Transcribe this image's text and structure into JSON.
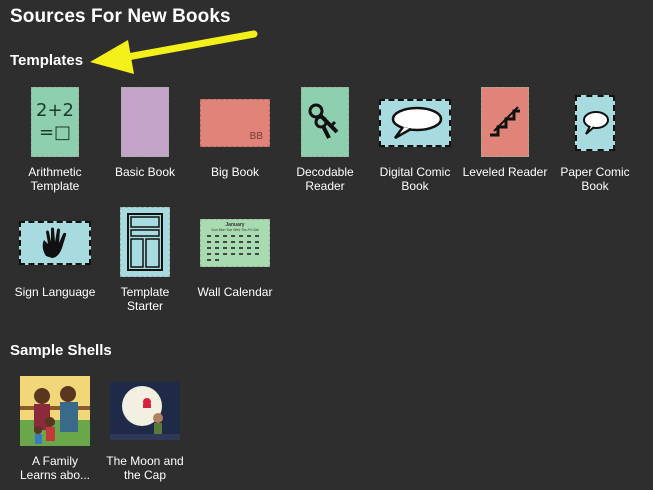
{
  "page_title": "Sources For New Books",
  "sections": {
    "templates": {
      "title": "Templates"
    },
    "sample_shells": {
      "title": "Sample Shells"
    }
  },
  "templates": [
    {
      "label": "Arithmetic Template",
      "thumb_text": "2+2\n=□",
      "color": "#8ecfb0"
    },
    {
      "label": "Basic Book",
      "color": "#c4a4c8"
    },
    {
      "label": "Big Book",
      "thumb_text": "BB",
      "color": "#e0847a"
    },
    {
      "label": "Decodable Reader",
      "color": "#8ecfb0",
      "icon": "keys-icon"
    },
    {
      "label": "Digital Comic Book",
      "color": "#a8dbe0",
      "icon": "speech-bubble-icon"
    },
    {
      "label": "Leveled Reader",
      "color": "#e0847a",
      "icon": "stairs-icon"
    },
    {
      "label": "Paper Comic Book",
      "color": "#a8dbe0",
      "icon": "speech-bubble-icon"
    },
    {
      "label": "Sign Language",
      "color": "#a8dbe0",
      "icon": "hand-icon"
    },
    {
      "label": "Template Starter",
      "color": "#a8dbe0",
      "icon": "layout-icon"
    },
    {
      "label": "Wall Calendar",
      "thumb_text": "January",
      "color": "#a8dbb0"
    }
  ],
  "samples": [
    {
      "label": "A Family Learns abo...",
      "icon": "family-illustration"
    },
    {
      "label": "The Moon and the Cap",
      "icon": "moon-illustration"
    }
  ],
  "colors": {
    "background": "#2e2e2e",
    "arrow": "#f4f01a"
  },
  "calendar_day_header": "Sun Mon Tue Wed Thu Fri Sat"
}
